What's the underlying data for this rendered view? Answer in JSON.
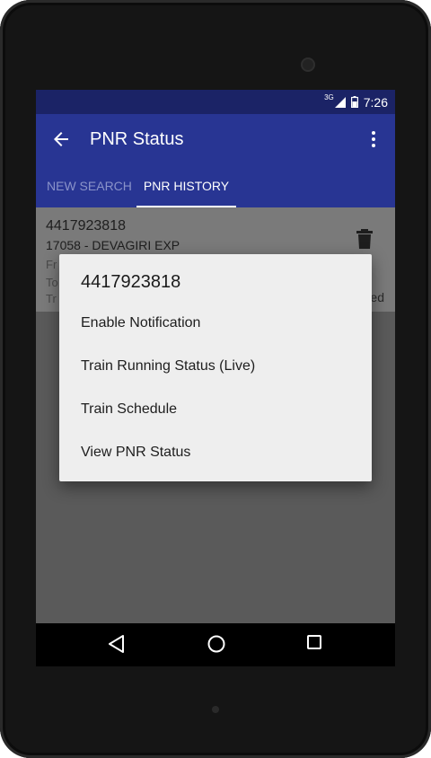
{
  "status_bar": {
    "network_label": "3G",
    "time": "7:26"
  },
  "app_bar": {
    "title": "PNR Status"
  },
  "tabs": [
    {
      "label": "NEW SEARCH",
      "selected": false
    },
    {
      "label": "PNR HISTORY",
      "selected": true
    }
  ],
  "history_card": {
    "pnr": "4417923818",
    "train": "17058 - DEVAGIRI EXP",
    "line_from_partial": "Fr",
    "line_to_partial": "To",
    "line_t_partial": "Tr",
    "status_partial": "ed"
  },
  "dialog": {
    "title": "4417923818",
    "items": [
      {
        "label": "Enable Notification"
      },
      {
        "label": "Train Running Status (Live)"
      },
      {
        "label": "Train Schedule"
      },
      {
        "label": "View PNR Status"
      }
    ]
  },
  "colors": {
    "status_bar": "#1b2366",
    "app_bar": "#283593",
    "tab_inactive": "#8a93c9",
    "dialog_bg": "#eeeeee",
    "scrim": "#5a5a5a"
  },
  "icons": [
    "back-arrow-icon",
    "overflow-menu-icon",
    "delete-icon",
    "signal-icon",
    "battery-icon",
    "nav-back-icon",
    "nav-home-icon",
    "nav-recent-icon"
  ]
}
